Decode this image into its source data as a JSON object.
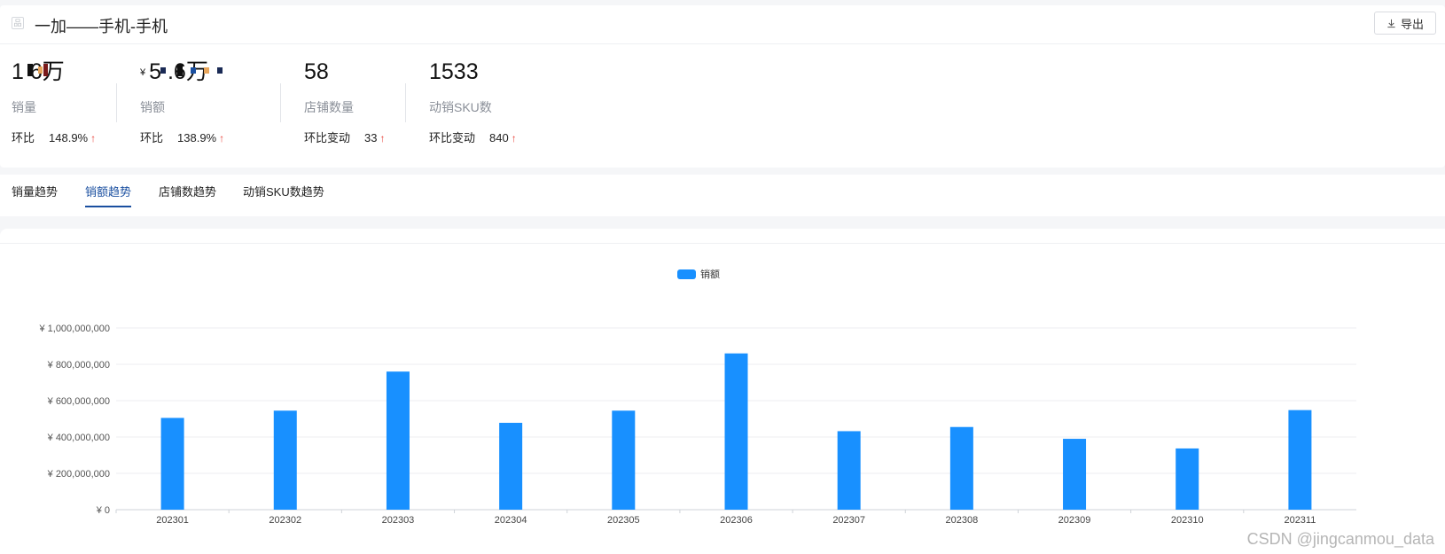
{
  "header": {
    "title": "一加——手机-手机",
    "export_label": "导出"
  },
  "metrics": [
    {
      "value_text": "1 6万",
      "label": "销量",
      "change_label": "环比",
      "change_value": "148.9%"
    },
    {
      "currency": "¥",
      "value_text": "5 .6万",
      "label": "销额",
      "change_label": "环比",
      "change_value": "138.9%"
    },
    {
      "value_text": "58",
      "label": "店铺数量",
      "change_label": "环比变动",
      "change_value": "33"
    },
    {
      "value_text": "1533",
      "label": "动销SKU数",
      "change_label": "环比变动",
      "change_value": "840"
    }
  ],
  "tabs": [
    {
      "label": "销量趋势",
      "active": false
    },
    {
      "label": "销额趋势",
      "active": true
    },
    {
      "label": "店铺数趋势",
      "active": false
    },
    {
      "label": "动销SKU数趋势",
      "active": false
    }
  ],
  "chart_data": {
    "type": "bar",
    "categories": [
      "202301",
      "202302",
      "202303",
      "202304",
      "202305",
      "202306",
      "202307",
      "202308",
      "202309",
      "202310",
      "202311"
    ],
    "series": [
      {
        "name": "销额",
        "color": "#1890ff",
        "values": [
          505000000,
          545000000,
          760000000,
          478000000,
          545000000,
          860000000,
          432000000,
          455000000,
          390000000,
          337000000,
          548000000
        ]
      }
    ],
    "ylim": [
      0,
      1000000000
    ],
    "yticks": [
      0,
      200000000,
      400000000,
      600000000,
      800000000,
      1000000000
    ],
    "ytick_labels": [
      "¥ 0",
      "¥ 200,000,000",
      "¥ 400,000,000",
      "¥ 600,000,000",
      "¥ 800,000,000",
      "¥ 1,000,000,000"
    ],
    "legend_position": "top-center",
    "grid": true
  },
  "watermark": "CSDN @jingcanmou_data",
  "colors": {
    "accent": "#1a4fa0",
    "bar": "#1890ff",
    "up_arrow": "#e8453c"
  }
}
